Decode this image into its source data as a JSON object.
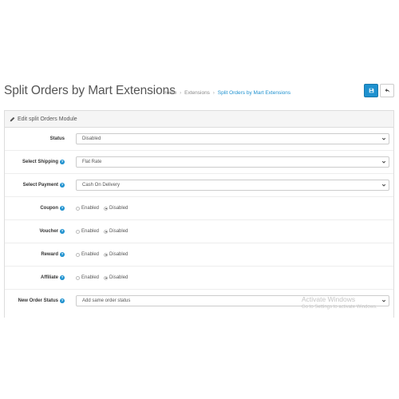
{
  "header": {
    "title": "Split Orders by Mart Extensions",
    "breadcrumb": [
      {
        "label": "Home"
      },
      {
        "label": "Extensions"
      },
      {
        "label": "Split Orders by Mart Extensions"
      }
    ],
    "save_icon": "save-icon",
    "back_icon": "reply-icon"
  },
  "panel": {
    "heading": "Edit split Orders Module",
    "heading_icon": "pencil-icon"
  },
  "form": {
    "status": {
      "label": "Status",
      "value": "Disabled"
    },
    "shipping": {
      "label": "Select Shipping",
      "value": "Flat Rate"
    },
    "payment": {
      "label": "Select Payment",
      "value": "Cash On Delivery"
    },
    "coupon": {
      "label": "Coupon",
      "option_enabled": "Enabled",
      "option_disabled": "Disabled",
      "selected": "Disabled"
    },
    "voucher": {
      "label": "Voucher",
      "option_enabled": "Enabled",
      "option_disabled": "Disabled",
      "selected": "Disabled"
    },
    "reward": {
      "label": "Reward",
      "option_enabled": "Enabled",
      "option_disabled": "Disabled",
      "selected": "Disabled"
    },
    "affiliate": {
      "label": "Affiliate",
      "option_enabled": "Enabled",
      "option_disabled": "Disabled",
      "selected": "Disabled"
    },
    "order_status": {
      "label": "New Order Status",
      "value": "Add same order status"
    }
  },
  "watermark": {
    "title": "Activate Windows",
    "subtitle": "Go to Settings to activate Windows."
  },
  "colors": {
    "primary": "#1e91cf",
    "heading_bg": "#f5f5f5"
  }
}
